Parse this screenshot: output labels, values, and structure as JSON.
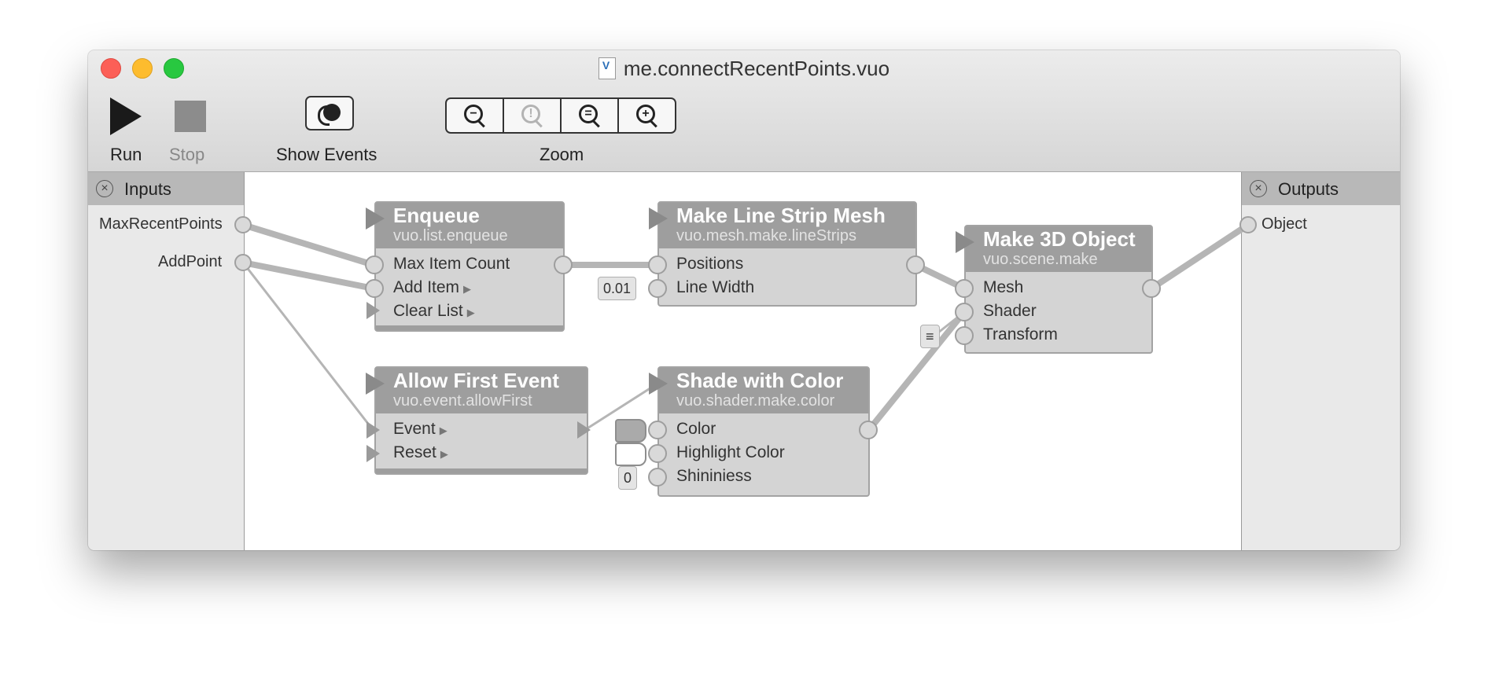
{
  "window": {
    "title": "me.connectRecentPoints.vuo"
  },
  "toolbar": {
    "run": "Run",
    "stop": "Stop",
    "show_events": "Show Events",
    "zoom": "Zoom"
  },
  "inputs_panel": {
    "title": "Inputs",
    "ports": [
      "MaxRecentPoints",
      "AddPoint"
    ]
  },
  "outputs_panel": {
    "title": "Outputs",
    "ports": [
      "Object"
    ]
  },
  "nodes": {
    "enqueue": {
      "title": "Enqueue",
      "class": "vuo.list.enqueue",
      "ports": [
        "Max Item Count",
        "Add Item",
        "Clear List"
      ]
    },
    "line_strip": {
      "title": "Make Line Strip Mesh",
      "class": "vuo.mesh.make.lineStrips",
      "ports": [
        "Positions",
        "Line Width"
      ],
      "constants": {
        "line_width": "0.01"
      }
    },
    "make3d": {
      "title": "Make 3D Object",
      "class": "vuo.scene.make",
      "ports": [
        "Mesh",
        "Shader",
        "Transform"
      ],
      "constants": {
        "transform": "≡"
      }
    },
    "allow_first": {
      "title": "Allow First Event",
      "class": "vuo.event.allowFirst",
      "ports": [
        "Event",
        "Reset"
      ]
    },
    "shade_color": {
      "title": "Shade with Color",
      "class": "vuo.shader.make.color",
      "ports": [
        "Color",
        "Highlight Color",
        "Shininiess"
      ],
      "constants": {
        "shininess": "0"
      }
    }
  },
  "colors": {
    "node_header": "#9e9e9e",
    "node_body": "#d4d4d4",
    "wire": "#b5b5b5",
    "color_swatch": "#aaaaaa",
    "highlight_swatch": "#ffffff"
  },
  "icons": {
    "run": "play-icon",
    "stop": "stop-icon",
    "show_events": "show-events-icon",
    "zoom": [
      "zoom-out-icon",
      "zoom-actual-icon",
      "zoom-to-fit-icon",
      "zoom-in-icon"
    ]
  }
}
